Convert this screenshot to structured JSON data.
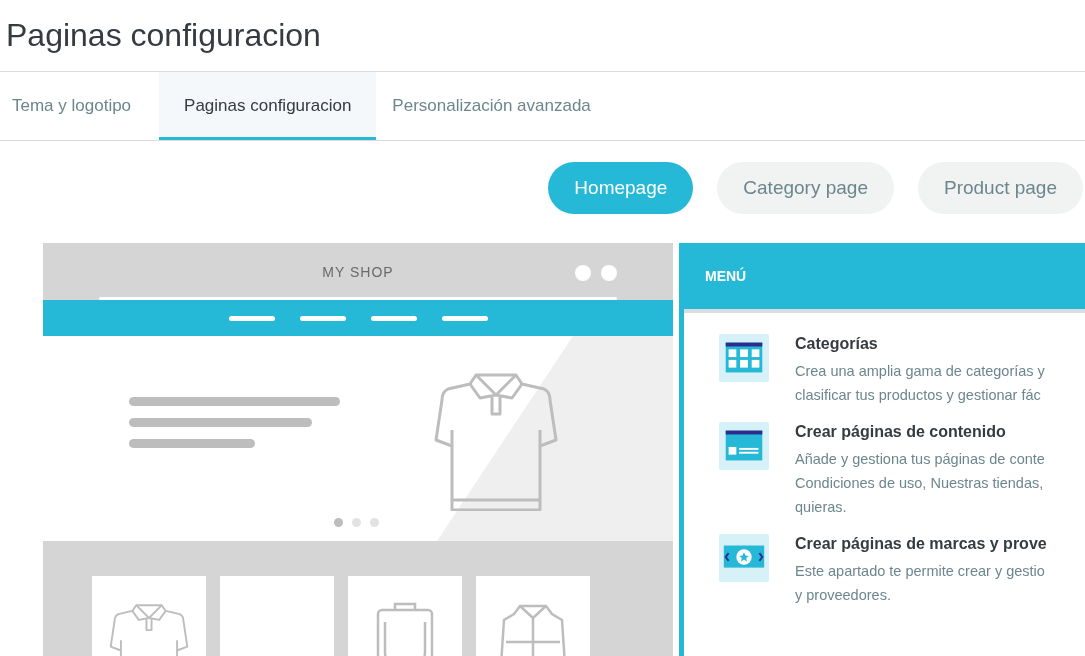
{
  "title": "Paginas configuracion",
  "tabs": [
    {
      "label": "Tema y logotipo",
      "selected": false
    },
    {
      "label": "Paginas configuracion",
      "selected": true
    },
    {
      "label": "Personalización avanzada",
      "selected": false
    }
  ],
  "page_buttons": [
    {
      "label": "Homepage",
      "selected": true
    },
    {
      "label": "Category page",
      "selected": false
    },
    {
      "label": "Product page",
      "selected": false
    }
  ],
  "preview": {
    "shop_name": "MY SHOP",
    "carousel_dots": [
      {
        "selected": true
      },
      {
        "selected": false
      },
      {
        "selected": false
      }
    ]
  },
  "menu_panel": {
    "header": "MENÚ",
    "items": [
      {
        "kind": "grid",
        "title": "Categorías",
        "lines": [
          "Crea una amplia gama de categorías y",
          "clasificar tus productos y gestionar fác"
        ]
      },
      {
        "kind": "page",
        "title": "Crear páginas de contenido",
        "lines": [
          "Añade y gestiona tus páginas de conte",
          "Condiciones de uso, Nuestras tiendas,",
          "quieras."
        ]
      },
      {
        "kind": "slider",
        "title": "Crear páginas de marcas y prove",
        "lines": [
          "Este apartado te permite crear y gestio",
          "y proveedores."
        ]
      }
    ]
  }
}
